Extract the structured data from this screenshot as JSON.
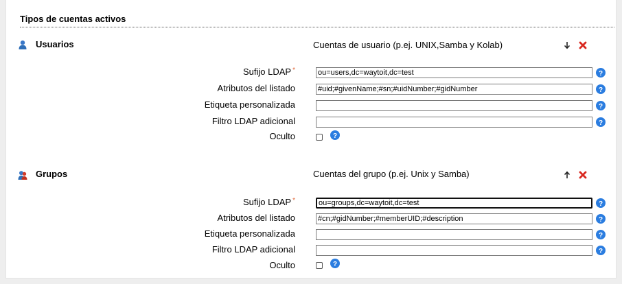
{
  "section": {
    "title": "Tipos de cuentas activos"
  },
  "colors": {
    "help_blue": "#2b7de0",
    "delete_red": "#d9281f",
    "required_orange": "#e06a3c"
  },
  "accounts": [
    {
      "name": "Usuarios",
      "icon": "user-icon",
      "description": "Cuentas de usuario (p.ej. UNIX,Samba y Kolab)",
      "move_icon": "arrow-down-icon",
      "fields": {
        "suffix_label": "Sufijo LDAP",
        "suffix_value": "ou=users,dc=waytoit,dc=test",
        "attrs_label": "Atributos del listado",
        "attrs_value": "#uid;#givenName;#sn;#uidNumber;#gidNumber",
        "custom_label": "Etiqueta personalizada",
        "custom_value": "",
        "filter_label": "Filtro LDAP adicional",
        "filter_value": "",
        "hidden_label": "Oculto"
      }
    },
    {
      "name": "Grupos",
      "icon": "group-icon",
      "description": "Cuentas del grupo (p.ej. Unix y Samba)",
      "move_icon": "arrow-up-icon",
      "fields": {
        "suffix_label": "Sufijo LDAP",
        "suffix_value": "ou=groups,dc=waytoit,dc=test",
        "attrs_label": "Atributos del listado",
        "attrs_value": "#cn;#gidNumber;#memberUID;#description",
        "custom_label": "Etiqueta personalizada",
        "custom_value": "",
        "filter_label": "Filtro LDAP adicional",
        "filter_value": "",
        "hidden_label": "Oculto"
      }
    }
  ]
}
